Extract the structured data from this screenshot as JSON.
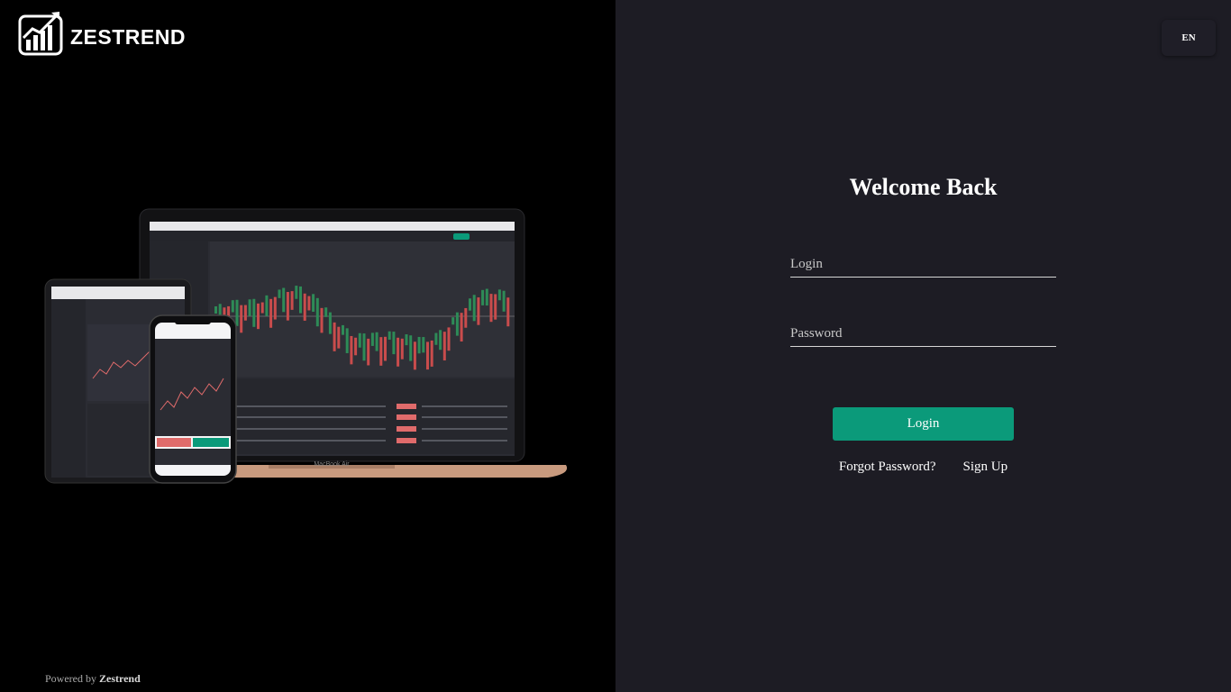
{
  "brand": {
    "name": "ZESTREND"
  },
  "footer": {
    "powered_prefix": "Powered by",
    "powered_name": "Zestrend"
  },
  "header": {
    "language": "EN"
  },
  "form": {
    "title": "Welcome Back",
    "login_placeholder": "Login",
    "password_placeholder": "Password",
    "login_button": "Login",
    "forgot_link": "Forgot Password?",
    "signup_link": "Sign Up"
  },
  "hero": {
    "laptop_label": "MacBook Air"
  },
  "colors": {
    "accent": "#0b9a7a",
    "panel": "#1d1c24",
    "left_bg": "#000000"
  }
}
